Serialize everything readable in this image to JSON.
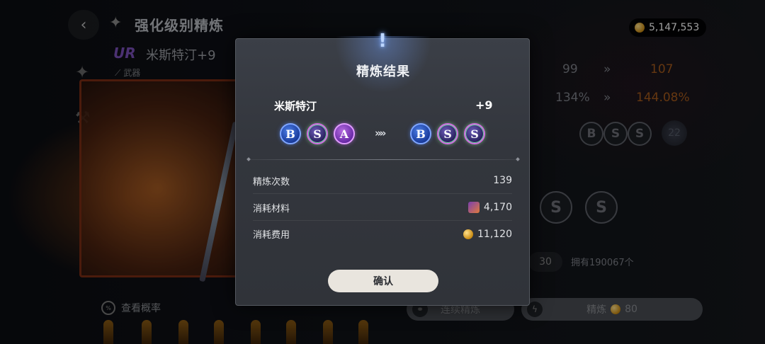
{
  "background": {
    "page_title": "强化级别精炼",
    "rarity_badge": "UR",
    "item_name": "米斯特汀+9",
    "item_type": "武器",
    "gold_amount": "5,147,553",
    "stat_row1": {
      "from": "99",
      "to": "107"
    },
    "stat_row2": {
      "from": "134%",
      "to": "144.08%"
    },
    "gems_current": [
      "B",
      "S",
      "S"
    ],
    "star_level": "22",
    "big_gems": [
      "S",
      "S"
    ],
    "quantity": "30",
    "owned_text": "拥有190067个",
    "auto_refine_label": "连续精炼",
    "refine_label": "精炼",
    "refine_cost": "80",
    "probability_link": "查看概率"
  },
  "modal": {
    "title": "精炼结果",
    "item_name": "米斯特汀",
    "level": "+9",
    "gems_before": [
      "B",
      "S",
      "A"
    ],
    "gems_after": [
      "B",
      "S",
      "S"
    ],
    "arrow": "»»",
    "rows": [
      {
        "label": "精炼次数",
        "value": "139"
      },
      {
        "label": "消耗材料",
        "value": "4,170"
      },
      {
        "label": "消耗费用",
        "value": "11,120"
      }
    ],
    "confirm_label": "确认"
  }
}
